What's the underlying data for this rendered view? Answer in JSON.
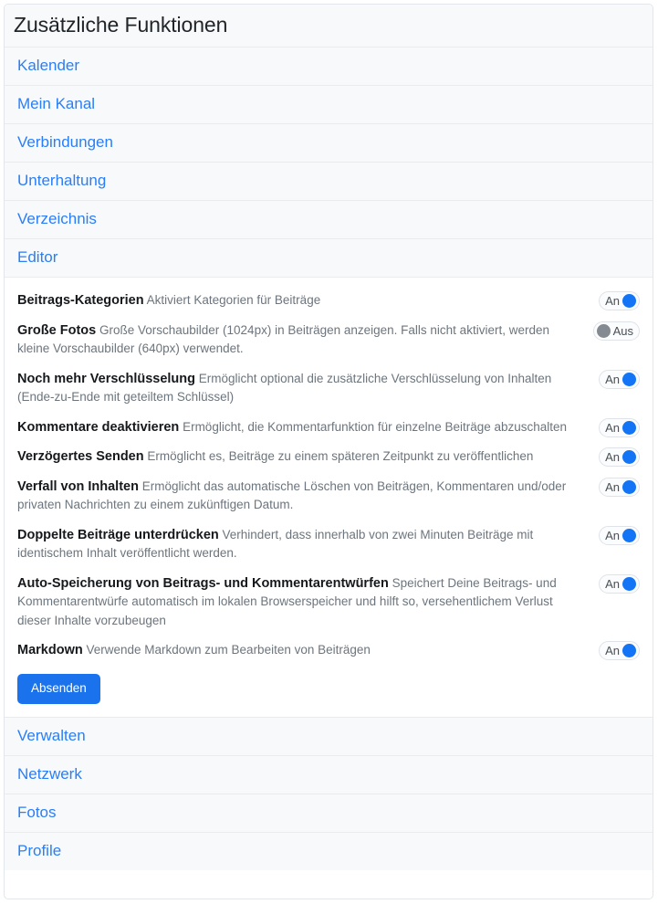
{
  "panel": {
    "title": "Zusätzliche Funktionen"
  },
  "top_sections": [
    {
      "label": "Kalender",
      "active": false
    },
    {
      "label": "Mein Kanal",
      "active": false
    },
    {
      "label": "Verbindungen",
      "active": false
    },
    {
      "label": "Unterhaltung",
      "active": false
    },
    {
      "label": "Verzeichnis",
      "active": false
    },
    {
      "label": "Editor",
      "active": true
    }
  ],
  "settings": [
    {
      "label": "Beitrags-Kategorien",
      "description": "Aktiviert Kategorien für Beiträge",
      "state": "on",
      "state_label": "An"
    },
    {
      "label": "Große Fotos",
      "description": "Große Vorschaubilder (1024px) in Beiträgen anzeigen. Falls nicht aktiviert, werden kleine Vorschaubilder (640px) verwendet.",
      "state": "off",
      "state_label": "Aus"
    },
    {
      "label": "Noch mehr Verschlüsselung",
      "description": "Ermöglicht optional die zusätzliche Verschlüsselung von Inhalten (Ende-zu-Ende mit geteiltem Schlüssel)",
      "state": "on",
      "state_label": "An"
    },
    {
      "label": "Kommentare deaktivieren",
      "description": "Ermöglicht, die Kommentarfunktion für einzelne Beiträge abzuschalten",
      "state": "on",
      "state_label": "An"
    },
    {
      "label": "Verzögertes Senden",
      "description": "Ermöglicht es, Beiträge zu einem späteren Zeitpunkt zu veröffentlichen",
      "state": "on",
      "state_label": "An"
    },
    {
      "label": "Verfall von Inhalten",
      "description": "Ermöglicht das automatische Löschen von Beiträgen, Kommentaren und/oder privaten Nachrichten zu einem zukünftigen Datum.",
      "state": "on",
      "state_label": "An"
    },
    {
      "label": "Doppelte Beiträge unterdrücken",
      "description": "Verhindert, dass innerhalb von zwei Minuten Beiträge mit identischem Inhalt veröffentlicht werden.",
      "state": "on",
      "state_label": "An"
    },
    {
      "label": "Auto-Speicherung von Beitrags- und Kommentarentwürfen",
      "description": "Speichert Deine Beitrags- und Kommentarentwürfe automatisch im lokalen Browserspeicher und hilft so, versehentlichem Verlust dieser Inhalte vorzubeugen",
      "state": "on",
      "state_label": "An"
    },
    {
      "label": "Markdown",
      "description": "Verwende Markdown zum Bearbeiten von Beiträgen",
      "state": "on",
      "state_label": "An"
    }
  ],
  "submit": {
    "label": "Absenden"
  },
  "bottom_sections": [
    {
      "label": "Verwalten"
    },
    {
      "label": "Netzwerk"
    },
    {
      "label": "Fotos"
    },
    {
      "label": "Profile"
    }
  ],
  "colors": {
    "link": "#2a7ef7",
    "toggle_on": "#1374f5",
    "toggle_off": "#848a91",
    "button": "#1a73ed",
    "section_bg": "#f8f9fa"
  }
}
